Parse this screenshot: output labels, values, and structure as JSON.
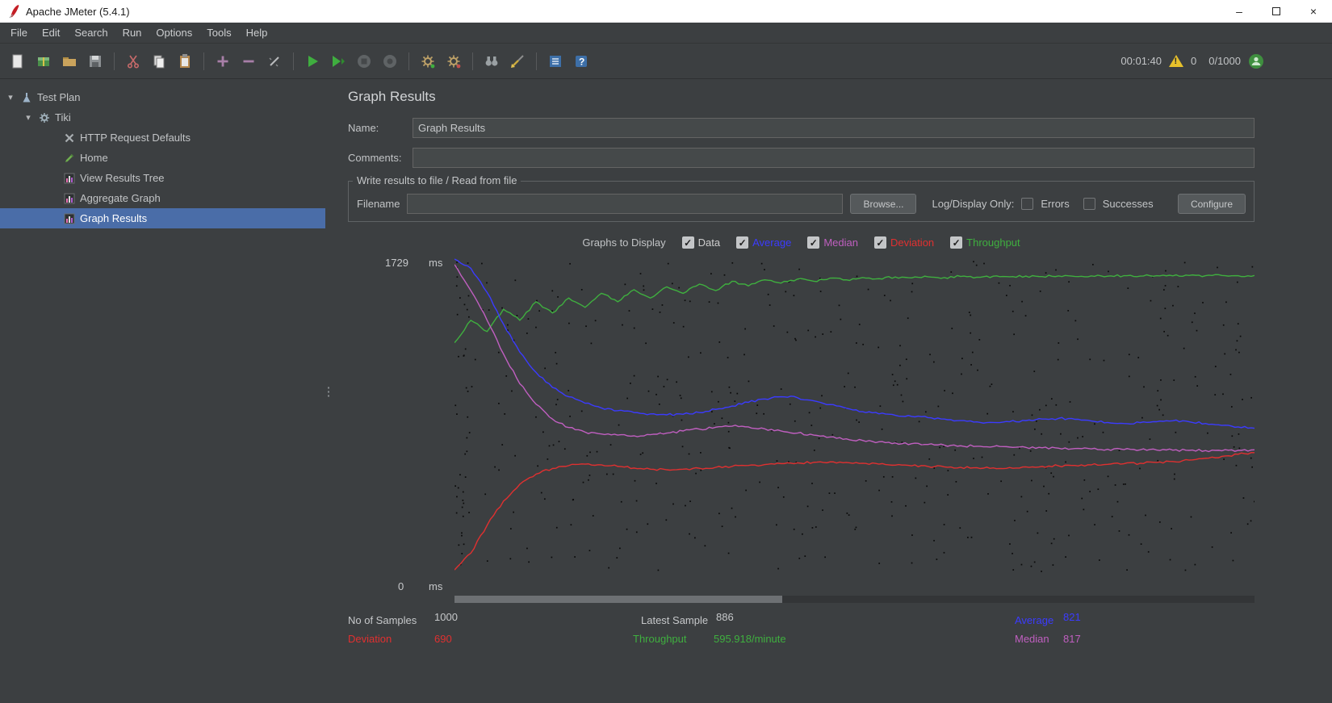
{
  "window": {
    "title": "Apache JMeter (5.4.1)"
  },
  "menubar": {
    "items": [
      "File",
      "Edit",
      "Search",
      "Run",
      "Options",
      "Tools",
      "Help"
    ]
  },
  "toolbar": {
    "icons": [
      "new-file",
      "templates",
      "open-file",
      "save",
      "cut",
      "copy",
      "paste",
      "expand-add",
      "collapse-remove",
      "toggle",
      "start",
      "start-no-pauses",
      "stop",
      "shutdown",
      "remote-start-all",
      "remote-stop-all",
      "search",
      "clear",
      "function-helper",
      "help"
    ],
    "status": {
      "elapsed_time": "00:01:40",
      "error_count": "0",
      "threads": "0/1000"
    }
  },
  "tree": {
    "items": [
      {
        "label": "Test Plan",
        "level": 0,
        "expanded": true,
        "icon": "test-plan-flask",
        "selected": false
      },
      {
        "label": "Tiki",
        "level": 1,
        "expanded": true,
        "icon": "gear",
        "selected": false
      },
      {
        "label": "HTTP Request Defaults",
        "level": 2,
        "icon": "crossed-tools",
        "selected": false
      },
      {
        "label": "Home",
        "level": 2,
        "icon": "sampler-dropper",
        "selected": false
      },
      {
        "label": "View Results Tree",
        "level": 2,
        "icon": "listener-chart",
        "selected": false
      },
      {
        "label": "Aggregate Graph",
        "level": 2,
        "icon": "listener-chart",
        "selected": false
      },
      {
        "label": "Graph Results",
        "level": 2,
        "icon": "listener-chart",
        "selected": true
      }
    ]
  },
  "main": {
    "title": "Graph Results",
    "name_label": "Name:",
    "name_value": "Graph Results",
    "comments_label": "Comments:",
    "comments_value": "",
    "file_group": {
      "title": "Write results to file / Read from file",
      "filename_label": "Filename",
      "filename_value": "",
      "browse_label": "Browse...",
      "log_display_label": "Log/Display Only:",
      "errors_label": "Errors",
      "errors_checked": false,
      "successes_label": "Successes",
      "successes_checked": false,
      "configure_label": "Configure"
    },
    "graphs_to_display": {
      "label": "Graphs to Display",
      "items": [
        {
          "label": "Data",
          "color": "#cfcfcf",
          "checked": true
        },
        {
          "label": "Average",
          "color": "#3b3bff",
          "checked": true
        },
        {
          "label": "Median",
          "color": "#c05fc0",
          "checked": true
        },
        {
          "label": "Deviation",
          "color": "#e03030",
          "checked": true
        },
        {
          "label": "Throughput",
          "color": "#3faf3f",
          "checked": true
        }
      ]
    },
    "chart_labels": {
      "y_max": "1729",
      "y_max_unit": "ms",
      "y_min": "0",
      "y_min_unit": "ms"
    },
    "stats": {
      "no_of_samples_label": "No of Samples",
      "no_of_samples": "1000",
      "deviation_label": "Deviation",
      "deviation": "690",
      "latest_sample_label": "Latest Sample",
      "latest_sample": "886",
      "throughput_label": "Throughput",
      "throughput": "595.918/minute",
      "average_label": "Average",
      "average": "821",
      "median_label": "Median",
      "median": "817"
    }
  },
  "chart_data": {
    "type": "line",
    "title": "Graph Results",
    "ylabel": "ms",
    "y_axis": {
      "min": 0,
      "max": 1729,
      "unit": "ms"
    },
    "grid": false,
    "legend_position": "top",
    "series": [
      {
        "name": "Throughput",
        "color": "#3faf3f",
        "values": [
          1280,
          1400,
          1340,
          1460,
          1400,
          1500,
          1440,
          1520,
          1470,
          1545,
          1500,
          1565,
          1520,
          1580,
          1545,
          1595,
          1560,
          1610,
          1585,
          1618,
          1600,
          1622,
          1610,
          1627,
          1618,
          1630,
          1624,
          1633,
          1628,
          1634,
          1630,
          1636,
          1632,
          1637,
          1634,
          1638,
          1635,
          1639,
          1636,
          1639,
          1637,
          1640,
          1638,
          1640,
          1639,
          1641,
          1640,
          1641,
          1640,
          1641
        ]
      },
      {
        "name": "Average",
        "color": "#3b3bff",
        "values": [
          1729,
          1680,
          1550,
          1380,
          1230,
          1120,
          1040,
          990,
          955,
          930,
          915,
          905,
          898,
          893,
          896,
          905,
          922,
          940,
          960,
          978,
          990,
          985,
          968,
          948,
          928,
          910,
          898,
          890,
          884,
          878,
          870,
          862,
          855,
          852,
          856,
          862,
          870,
          874,
          869,
          860,
          852,
          846,
          851,
          856,
          861,
          856,
          846,
          836,
          828,
          821
        ]
      },
      {
        "name": "Median",
        "color": "#c05fc0",
        "values": [
          1700,
          1560,
          1400,
          1220,
          1060,
          950,
          870,
          825,
          800,
          790,
          784,
          780,
          786,
          795,
          806,
          816,
          826,
          832,
          828,
          818,
          806,
          795,
          784,
          774,
          764,
          755,
          748,
          742,
          738,
          734,
          730,
          727,
          724,
          722,
          720,
          718,
          716,
          714,
          712,
          710,
          708,
          706,
          705,
          704,
          703,
          702,
          701,
          700,
          702,
          705
        ]
      },
      {
        "name": "Deviation",
        "color": "#e03030",
        "values": [
          60,
          150,
          300,
          430,
          520,
          575,
          605,
          620,
          628,
          624,
          616,
          607,
          601,
          598,
          601,
          606,
          611,
          616,
          621,
          626,
          631,
          635,
          638,
          640,
          637,
          633,
          628,
          623,
          619,
          616,
          613,
          611,
          609,
          608,
          610,
          613,
          616,
          619,
          621,
          624,
          627,
          630,
          633,
          637,
          642,
          650,
          660,
          670,
          681,
          690
        ]
      }
    ],
    "scatter": {
      "name": "Data",
      "color": "#0a0a0a",
      "count": 520,
      "seed": 42,
      "y_range": [
        50,
        1720
      ],
      "note": "approximate random scatter of 1000 sample response times"
    }
  }
}
